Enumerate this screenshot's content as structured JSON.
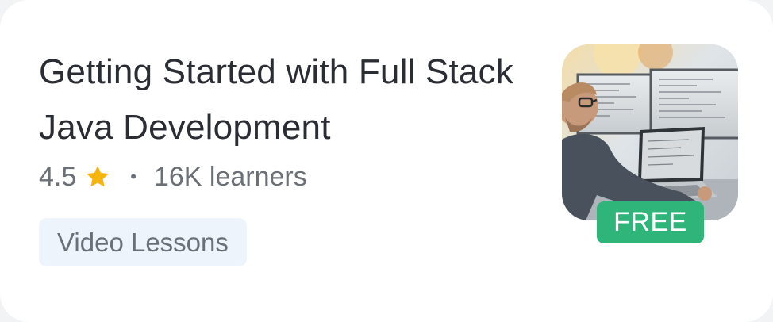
{
  "course": {
    "title": "Getting Started with Full Stack Java Development",
    "rating": "4.5",
    "separator": "•",
    "learners": "16K learners",
    "tag": "Video Lessons",
    "price_badge": "FREE"
  },
  "colors": {
    "star": "#f6b40e",
    "badge": "#2fb57a",
    "tag_bg": "#eef4fb",
    "title": "#2a2d33",
    "muted": "#6b6f76"
  },
  "icons": {
    "rating": "star-icon"
  }
}
